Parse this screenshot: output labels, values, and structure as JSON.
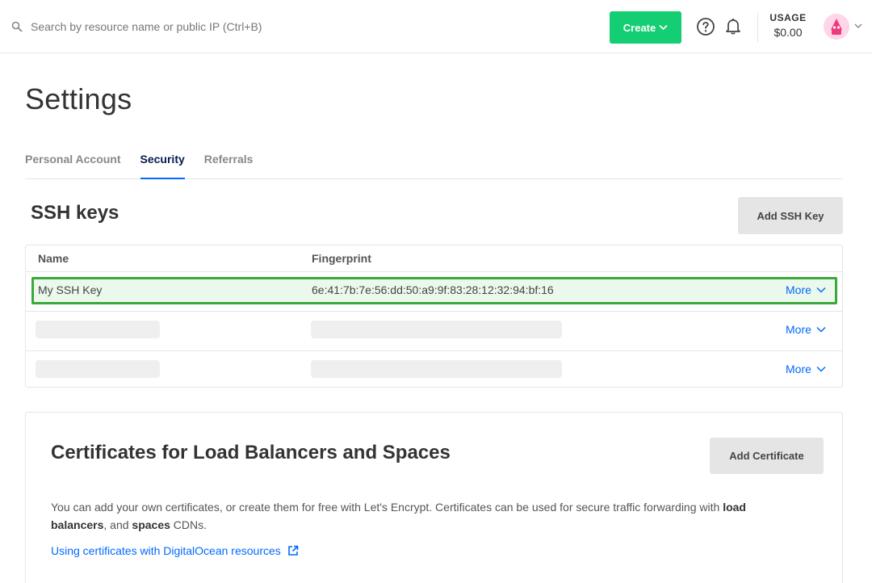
{
  "topbar": {
    "search_placeholder": "Search by resource name or public IP (Ctrl+B)",
    "create_label": "Create",
    "usage_label": "USAGE",
    "usage_value": "$0.00"
  },
  "page": {
    "title": "Settings",
    "tabs": [
      {
        "label": "Personal Account",
        "active": false
      },
      {
        "label": "Security",
        "active": true
      },
      {
        "label": "Referrals",
        "active": false
      }
    ]
  },
  "ssh": {
    "title": "SSH keys",
    "add_label": "Add SSH Key",
    "columns": [
      "Name",
      "Fingerprint"
    ],
    "rows": [
      {
        "name": "My SSH Key",
        "fingerprint": "6e:41:7b:7e:56:dd:50:a9:9f:83:28:12:32:94:bf:16",
        "more": "More"
      },
      {
        "name": "",
        "fingerprint": "",
        "more": "More"
      },
      {
        "name": "",
        "fingerprint": "",
        "more": "More"
      }
    ]
  },
  "certificates": {
    "title": "Certificates for Load Balancers and Spaces",
    "add_label": "Add Certificate",
    "desc_1": "You can add your own certificates, or create them for free with Let's Encrypt. Certificates can be used for secure traffic forwarding with ",
    "desc_bold_1": "load balancers",
    "desc_2": ", and ",
    "desc_bold_2": "spaces",
    "desc_3": " CDNs.",
    "link": "Using certificates with DigitalOcean resources"
  },
  "colors": {
    "accent": "#0069ff",
    "create_green": "#15cd72",
    "highlight_border": "#3aa83a",
    "highlight_fill": "#ebf9ec"
  },
  "icons": [
    "search-icon",
    "chevron-down-icon",
    "help-icon",
    "bell-icon",
    "avatar",
    "external-link-icon"
  ]
}
